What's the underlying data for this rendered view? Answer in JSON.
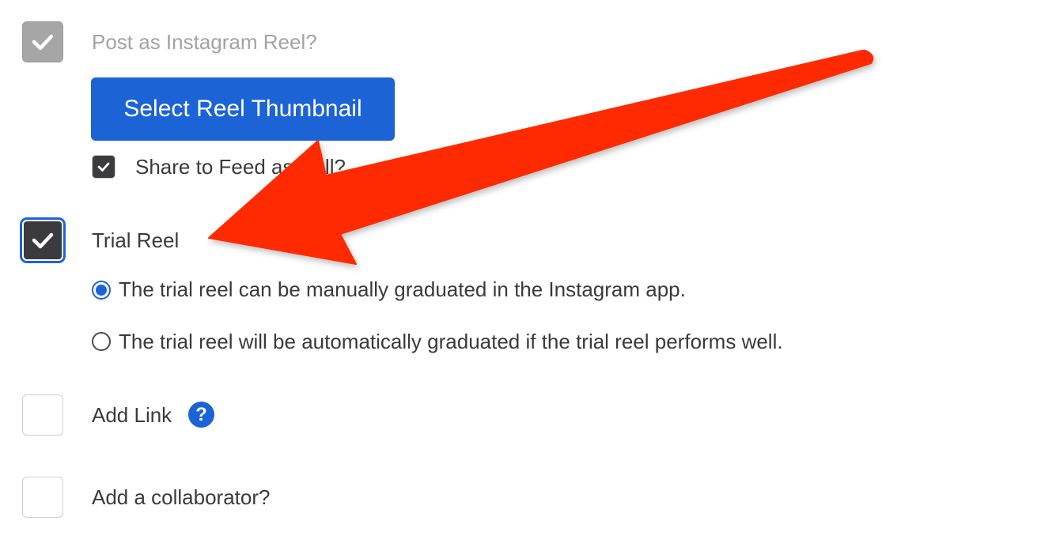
{
  "reel_option": {
    "label": "Post as Instagram Reel?",
    "checked": true,
    "disabled": true
  },
  "thumbnail_button": {
    "label": "Select Reel Thumbnail"
  },
  "share_feed": {
    "label": "Share to Feed as well?",
    "checked": true
  },
  "trial_reel": {
    "label": "Trial Reel",
    "checked": true,
    "options": [
      {
        "label": "The trial reel can be manually graduated in the Instagram app.",
        "selected": true
      },
      {
        "label": "The trial reel will be automatically graduated if the trial reel performs well.",
        "selected": false
      }
    ]
  },
  "add_link": {
    "label": "Add Link",
    "checked": false,
    "help_icon": "question-mark-icon",
    "help_symbol": "?"
  },
  "collaborator": {
    "label": "Add a collaborator?",
    "checked": false
  },
  "annotation": {
    "icon": "red-arrow-icon",
    "color": "#ff2a00"
  },
  "colors": {
    "accent": "#1c63d6",
    "checkbox_dark": "#3b3a3d",
    "checkbox_disabled": "#a6a6a6"
  }
}
